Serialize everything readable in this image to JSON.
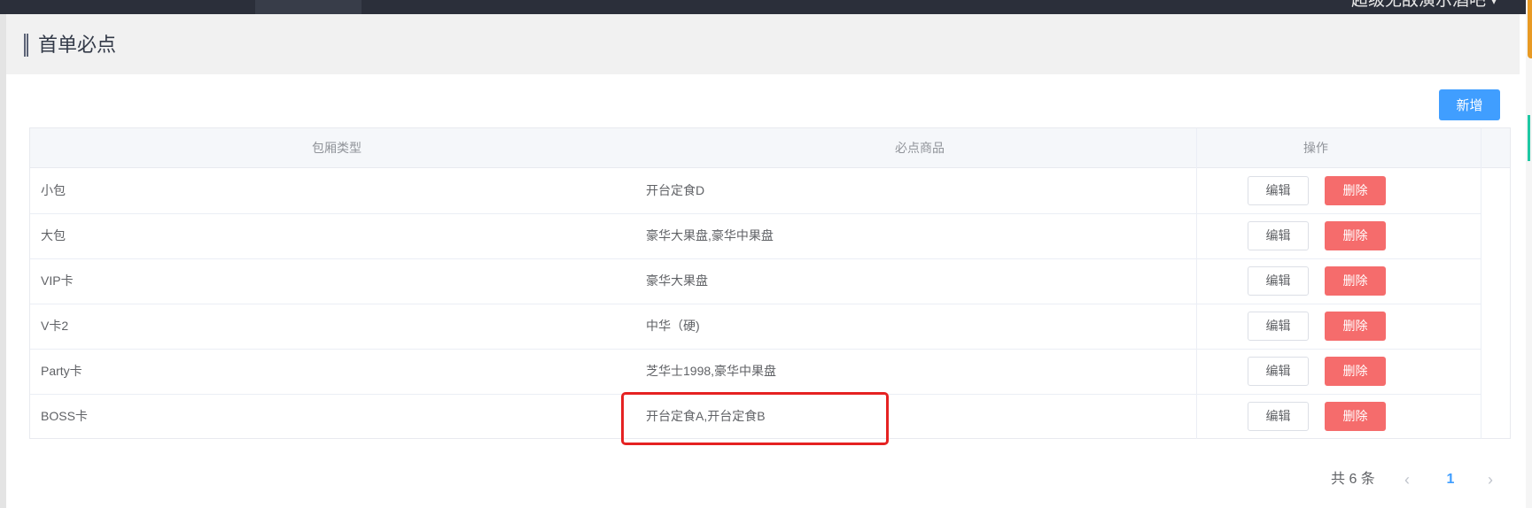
{
  "topbar": {
    "user_label": "超级无敌演示酒吧",
    "caret_icon": "chevron-down-icon"
  },
  "page": {
    "title": "首单必点"
  },
  "toolbar": {
    "add_label": "新增"
  },
  "table": {
    "headers": [
      "包厢类型",
      "必点商品",
      "操作"
    ],
    "rows": [
      {
        "type": "小包",
        "goods": "开台定食D",
        "edit": "编辑",
        "delete": "删除"
      },
      {
        "type": "大包",
        "goods": "豪华大果盘,豪华中果盘",
        "edit": "编辑",
        "delete": "删除"
      },
      {
        "type": "VIP卡",
        "goods": "豪华大果盘",
        "edit": "编辑",
        "delete": "删除"
      },
      {
        "type": "V卡2",
        "goods": "中华（硬)",
        "edit": "编辑",
        "delete": "删除"
      },
      {
        "type": "Party卡",
        "goods": "芝华士1998,豪华中果盘",
        "edit": "编辑",
        "delete": "删除"
      },
      {
        "type": "BOSS卡",
        "goods": "开台定食A,开台定食B",
        "edit": "编辑",
        "delete": "删除"
      }
    ]
  },
  "pagination": {
    "total_label": "共 6 条",
    "current_page": "1",
    "prev_icon": "chevron-left-icon",
    "next_icon": "chevron-right-icon"
  },
  "colors": {
    "primary": "#409eff",
    "danger": "#f56c6c",
    "highlight": "#e52222",
    "topbar": "#2b2f3a"
  }
}
